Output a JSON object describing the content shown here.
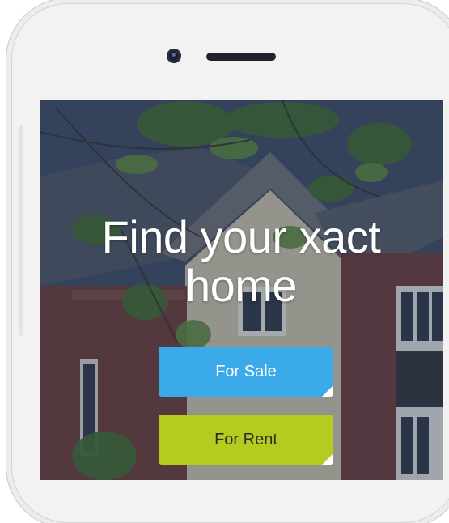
{
  "hero": {
    "title_line1": "Find your xact",
    "title_line2": "home"
  },
  "actions": {
    "sale_label": "For Sale",
    "rent_label": "For Rent"
  },
  "colors": {
    "sale_button": "#3aaae8",
    "rent_button": "#b4cc1f"
  }
}
